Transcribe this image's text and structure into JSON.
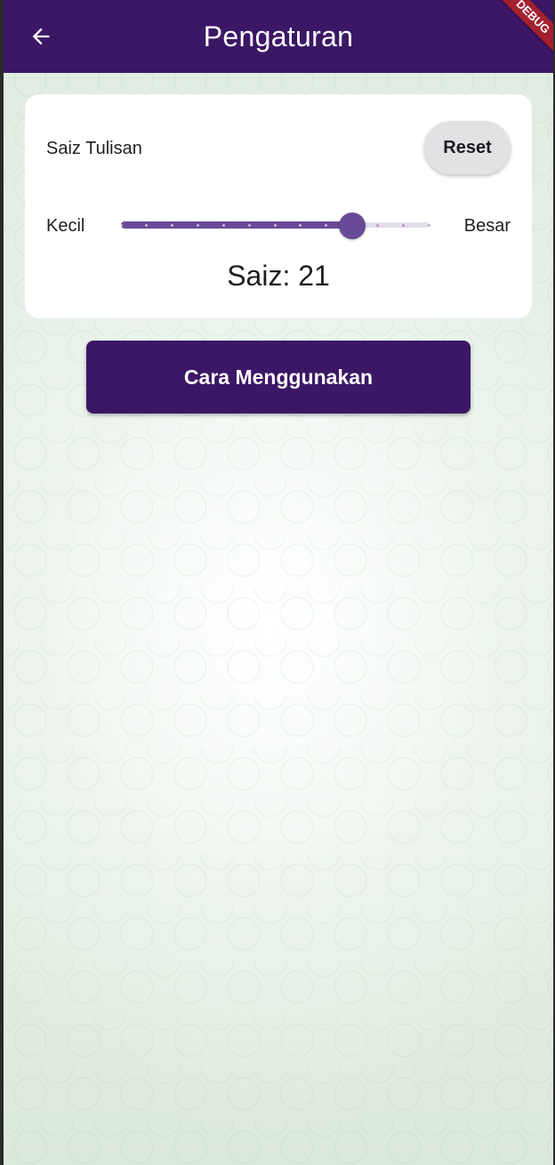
{
  "appbar": {
    "title": "Pengaturan",
    "back_icon": "arrow-back-icon",
    "background": "#3b1766"
  },
  "debug_banner": "DEBUG",
  "font_size_card": {
    "label": "Saiz Tulisan",
    "reset_label": "Reset",
    "min_label": "Kecil",
    "max_label": "Besar",
    "slider": {
      "min": 12,
      "max": 24,
      "value": 21
    },
    "size_text": "Saiz: 21"
  },
  "howto_button": {
    "label": "Cara Menggunakan"
  },
  "colors": {
    "primary": "#3b1766",
    "slider_active": "#6a4a98",
    "slider_inactive": "#e4dcec",
    "background": "#e6f0e6"
  }
}
